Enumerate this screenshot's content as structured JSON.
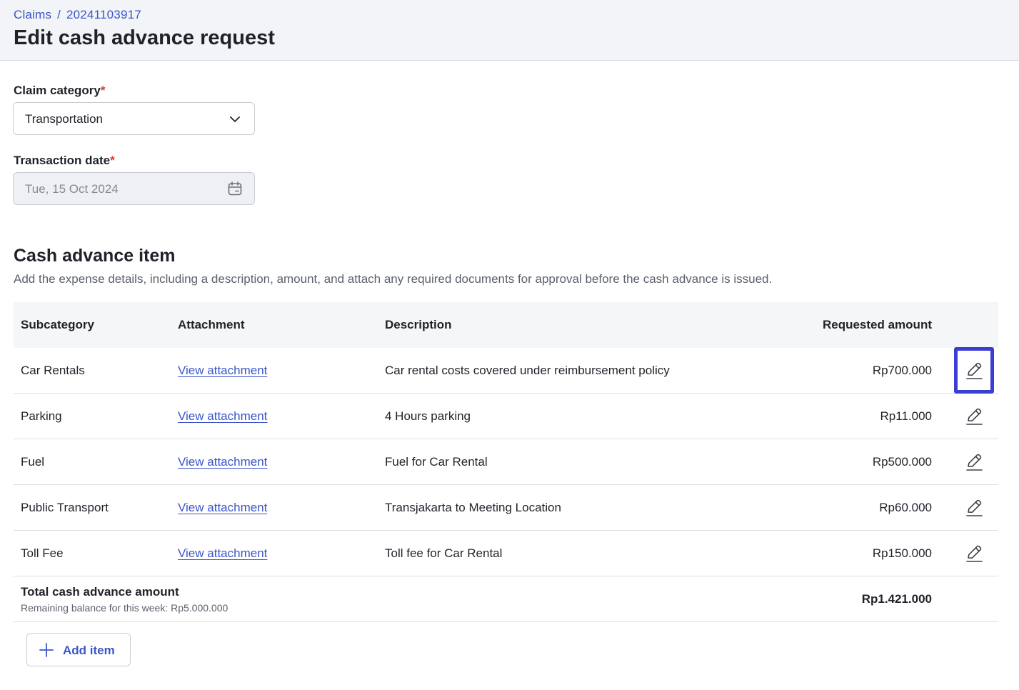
{
  "breadcrumb": {
    "root": "Claims",
    "separator": "/",
    "current": "20241103917"
  },
  "page_title": "Edit cash advance request",
  "form": {
    "claim_category": {
      "label": "Claim category",
      "required_mark": "*",
      "value": "Transportation",
      "icon": "chevron-down-icon"
    },
    "transaction_date": {
      "label": "Transaction date",
      "required_mark": "*",
      "value": "Tue, 15 Oct 2024",
      "icon": "calendar-icon",
      "disabled": true
    }
  },
  "section": {
    "title": "Cash advance item",
    "description": "Add the expense details, including a description, amount, and attach any required documents for approval before the cash advance is issued."
  },
  "table": {
    "headers": {
      "subcategory": "Subcategory",
      "attachment": "Attachment",
      "description": "Description",
      "amount": "Requested amount"
    },
    "rows": [
      {
        "subcategory": "Car Rentals",
        "attachment": "View attachment",
        "description": "Car rental costs covered under reimbursement policy",
        "amount": "Rp700.000"
      },
      {
        "subcategory": "Parking",
        "attachment": "View attachment",
        "description": "4 Hours parking",
        "amount": "Rp11.000"
      },
      {
        "subcategory": "Fuel",
        "attachment": "View attachment",
        "description": "Fuel for Car Rental",
        "amount": "Rp500.000"
      },
      {
        "subcategory": "Public Transport",
        "attachment": "View attachment",
        "description": "Transjakarta to Meeting Location",
        "amount": "Rp60.000"
      },
      {
        "subcategory": "Toll Fee",
        "attachment": "View attachment",
        "description": "Toll fee for Car Rental",
        "amount": "Rp150.000"
      }
    ],
    "total": {
      "label": "Total cash advance amount",
      "sub": "Remaining balance for this week: Rp5.000.000",
      "amount": "Rp1.421.000"
    }
  },
  "add_item": {
    "label": "Add item",
    "icon": "plus-icon"
  },
  "colors": {
    "accent": "#3a55c9",
    "focus": "#3b3fd1",
    "required": "#d93a3a",
    "header_bg": "#f2f4f8"
  }
}
